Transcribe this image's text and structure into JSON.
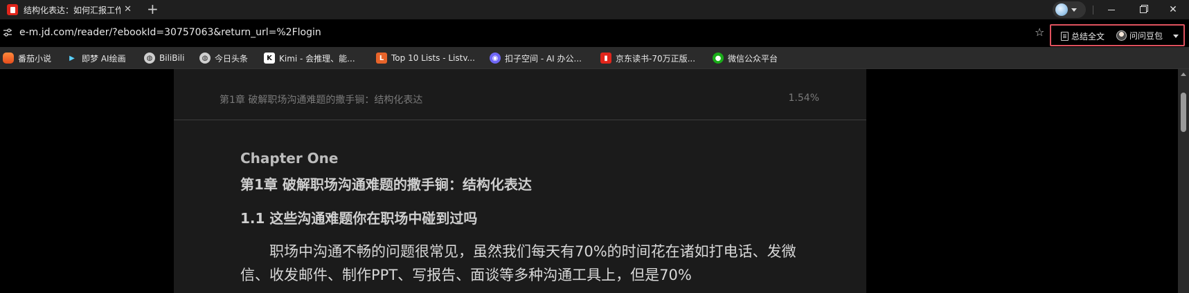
{
  "tab": {
    "title": "结构化表达：如何汇报工作",
    "close": "✕",
    "new_tab": "+"
  },
  "window": {
    "minimize": "—",
    "maximize": "▢",
    "close": "✕"
  },
  "address": {
    "url": "e-m.jd.com/reader/?ebookId=30757063&return_url=%2Flogin",
    "star": "☆"
  },
  "extensions": {
    "summary_label": "总结全文",
    "doubao_label": "问问豆包"
  },
  "bookmarks": [
    {
      "label": "番茄小说",
      "icon": "tomato-novel-icon",
      "glyph": ""
    },
    {
      "label": "即梦 AI绘画",
      "icon": "jimeng-icon",
      "glyph": "▶"
    },
    {
      "label": "BiliBili",
      "icon": "globe-icon",
      "glyph": "◍"
    },
    {
      "label": "今日头条",
      "icon": "globe-icon",
      "glyph": "◍"
    },
    {
      "label": "Kimi - 会推理、能...",
      "icon": "kimi-icon",
      "glyph": "K"
    },
    {
      "label": "Top 10 Lists - Listv...",
      "icon": "listverse-icon",
      "glyph": "L"
    },
    {
      "label": "扣子空间 - AI 办公...",
      "icon": "kouzi-icon",
      "glyph": "◉"
    },
    {
      "label": "京东读书-70万正版...",
      "icon": "jd-read-icon",
      "glyph": "▮"
    },
    {
      "label": "微信公众平台",
      "icon": "wechat-icon",
      "glyph": "●"
    }
  ],
  "reader": {
    "chapter_header": "第1章 破解职场沟通难题的撒手锏：结构化表达",
    "progress": "1.54%",
    "chapter_en": "Chapter One",
    "chapter_cn": "第1章 破解职场沟通难题的撒手锏：结构化表达",
    "section": "1.1 这些沟通难题你在职场中碰到过吗",
    "paragraph": "职场中沟通不畅的问题很常见，虽然我们每天有70%的时间花在诸如打电话、发微信、收发邮件、制作PPT、写报告、面谈等多种沟通工具上，但是70%"
  },
  "colors": {
    "page_bg": "#1b1b1b",
    "highlight_border": "#e0525e",
    "jd_red": "#e1251b"
  }
}
